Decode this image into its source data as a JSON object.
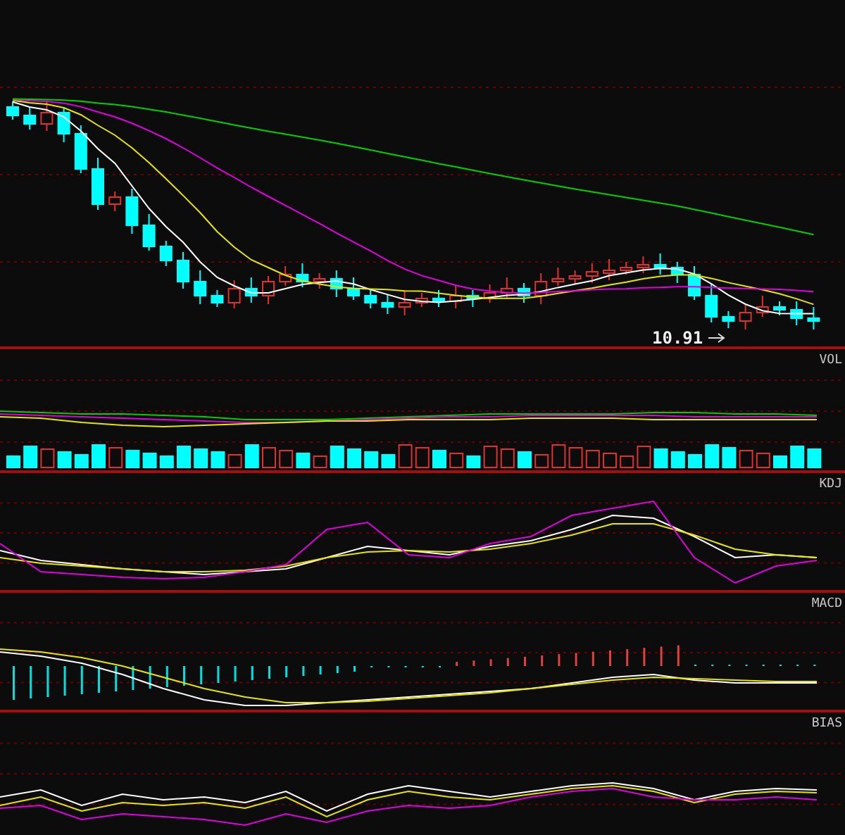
{
  "panels": [
    {
      "kind": "price",
      "price_marker": "10.91"
    },
    {
      "kind": "volume",
      "label": "VOL"
    },
    {
      "kind": "kdj",
      "label": "KDJ"
    },
    {
      "kind": "macd",
      "label": "MACD"
    },
    {
      "kind": "bias",
      "label": "BIAS"
    }
  ]
}
